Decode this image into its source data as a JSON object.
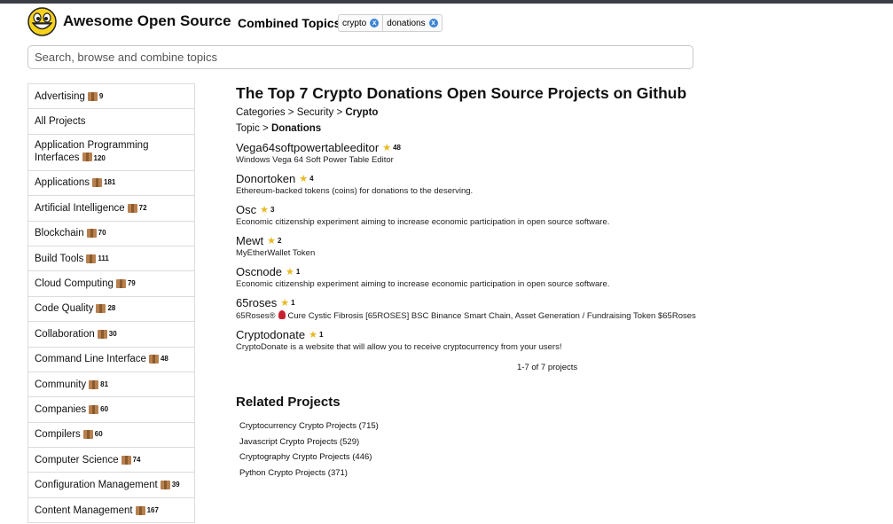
{
  "header": {
    "site_title": "Awesome Open Source",
    "combined_label": "Combined Topics",
    "chips": [
      {
        "label": "crypto",
        "remove": "x"
      },
      {
        "label": "donations",
        "remove": "x"
      }
    ]
  },
  "search": {
    "placeholder": "Search, browse and combine topics"
  },
  "sidebar": {
    "items": [
      {
        "label": "Advertising",
        "count": "9"
      },
      {
        "label": "All Projects",
        "count": ""
      },
      {
        "label": "Application Programming Interfaces",
        "count": "120"
      },
      {
        "label": "Applications",
        "count": "181"
      },
      {
        "label": "Artificial Intelligence",
        "count": "72"
      },
      {
        "label": "Blockchain",
        "count": "70"
      },
      {
        "label": "Build Tools",
        "count": "111"
      },
      {
        "label": "Cloud Computing",
        "count": "79"
      },
      {
        "label": "Code Quality",
        "count": "28"
      },
      {
        "label": "Collaboration",
        "count": "30"
      },
      {
        "label": "Command Line Interface",
        "count": "48"
      },
      {
        "label": "Community",
        "count": "81"
      },
      {
        "label": "Companies",
        "count": "60"
      },
      {
        "label": "Compilers",
        "count": "60"
      },
      {
        "label": "Computer Science",
        "count": "74"
      },
      {
        "label": "Configuration Management",
        "count": "39"
      },
      {
        "label": "Content Management",
        "count": "167"
      }
    ]
  },
  "main": {
    "title": "The Top 7 Crypto Donations Open Source Projects on Github",
    "breadcrumb": {
      "prefix": "Categories > Security > ",
      "current": "Crypto"
    },
    "topic": {
      "prefix": "Topic > ",
      "current": "Donations"
    },
    "projects": [
      {
        "name": "Vega64softpowertableeditor",
        "stars": "48",
        "description": "Windows Vega 64 Soft Power Table Editor"
      },
      {
        "name": "Donortoken",
        "stars": "4",
        "description": "Ethereum-backed tokens (coins) for donations to the deserving."
      },
      {
        "name": "Osc",
        "stars": "3",
        "description": "Economic citizenship experiment aiming to increase economic participation in open source software."
      },
      {
        "name": "Mewt",
        "stars": "2",
        "description": "MyEtherWallet Token"
      },
      {
        "name": "Oscnode",
        "stars": "1",
        "description": "Economic citizenship experiment aiming to increase economic participation in open source software."
      },
      {
        "name": "65roses",
        "stars": "1",
        "description_pre": "65Roses®",
        "description": "Cure Cystic Fibrosis [65ROSES] BSC Binance Smart Chain, Asset Generation / Fundraising Token $65Roses"
      },
      {
        "name": "Cryptodonate",
        "stars": "1",
        "description": "CryptoDonate is a website that will allow you to receive cryptocurrency from your users!"
      }
    ],
    "pager": "1-7 of 7 projects",
    "related_title": "Related Projects",
    "related": [
      "Cryptocurrency Crypto Projects (715)",
      "Javascript Crypto Projects (529)",
      "Cryptography Crypto Projects (446)",
      "Python Crypto Projects (371)"
    ]
  },
  "colors": {
    "star": "#e8b81f",
    "chip_remove": "#3a84d6",
    "topbar": "#3b3f45"
  },
  "icons": {
    "logo": "grinning-face-icon",
    "star": "star-icon",
    "package": "package-icon",
    "rose": "rose-icon"
  }
}
